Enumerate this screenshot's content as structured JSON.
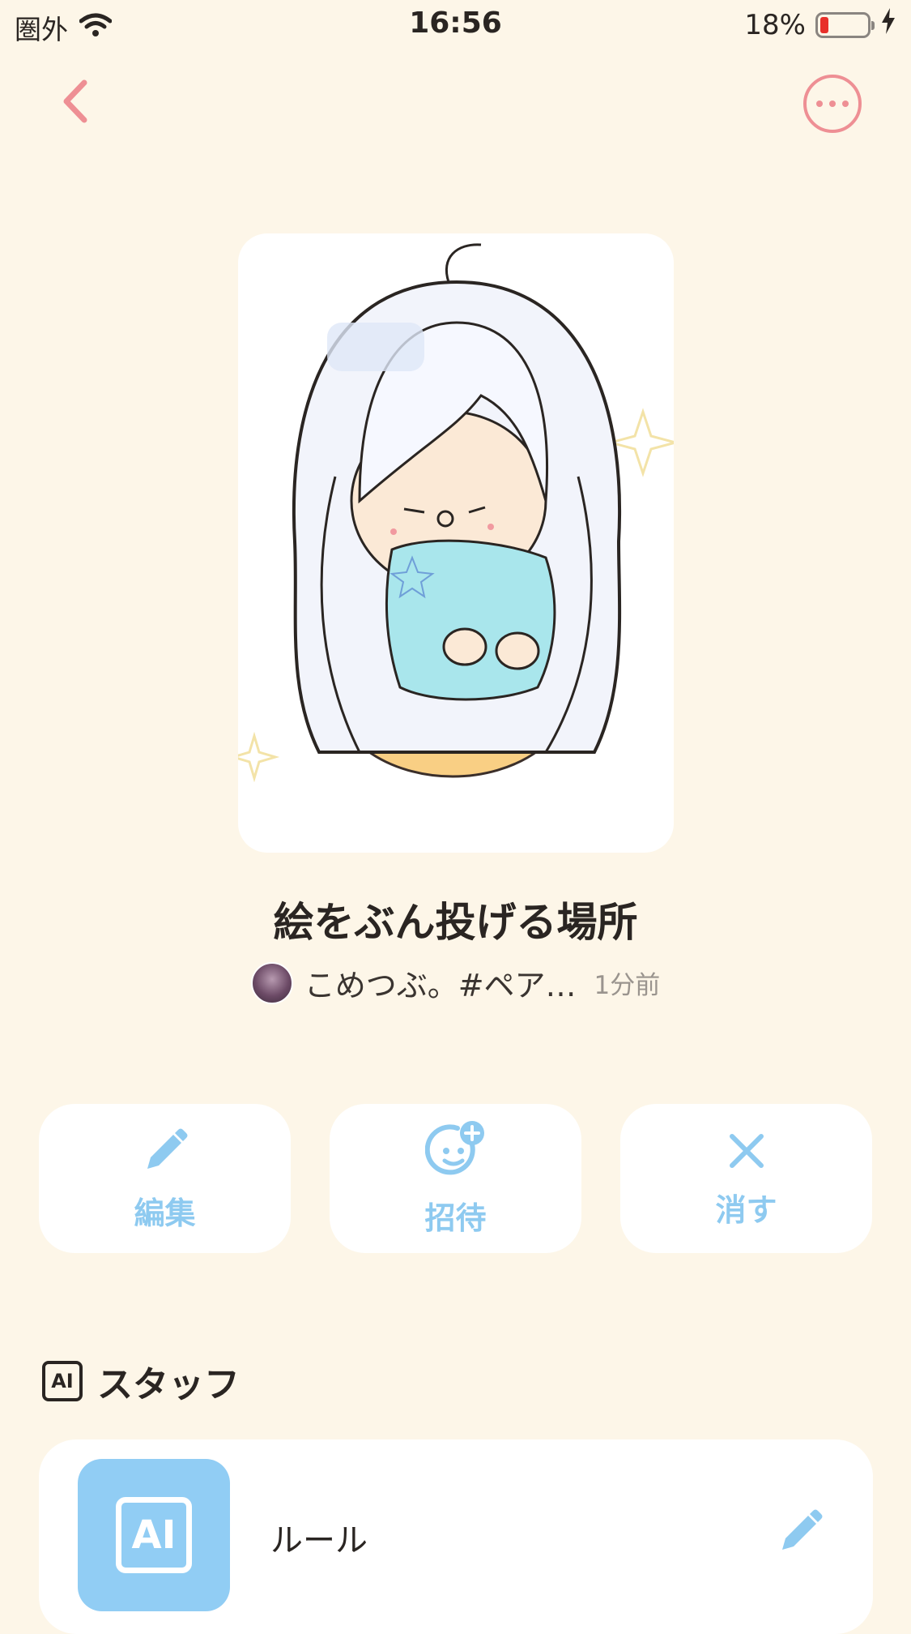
{
  "status_bar": {
    "carrier": "圏外",
    "time": "16:56",
    "battery": "18%",
    "battery_level": 0.18
  },
  "nav": {
    "back_icon": "chevron-left-icon",
    "more_icon": "more-horizontal-icon"
  },
  "room": {
    "title": "絵をぶん投げる場所",
    "author": "こめつぶ。#ペア…",
    "posted_ago": "1分前"
  },
  "actions": [
    {
      "label": "編集",
      "icon": "pencil-icon"
    },
    {
      "label": "招待",
      "icon": "invite-smiley-icon"
    },
    {
      "label": "消す",
      "icon": "close-icon"
    }
  ],
  "staff_section": {
    "title": "スタッフ",
    "badge": "AI",
    "items": [
      {
        "name": "ルール",
        "icon_text": "AI"
      }
    ]
  },
  "colors": {
    "background": "#fdf6e8",
    "accent_blue": "#8ecaf0",
    "accent_pink": "#ee8f94",
    "battery_red": "#e8302a"
  }
}
